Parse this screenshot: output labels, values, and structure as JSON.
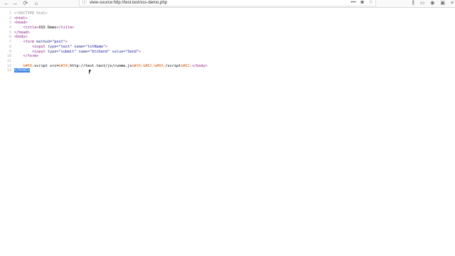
{
  "browser": {
    "url": "view-source:http://test.test/xss-demo.php",
    "buttons": {
      "back": "←",
      "forward": "→",
      "reload": "⟳",
      "home": "⌂"
    },
    "page_actions": {
      "more": "•••",
      "pocket": "◙",
      "bookmark": "☆"
    },
    "tools": {
      "library": "⫼",
      "sidebar": "▭",
      "account": "◉",
      "extension": "▣",
      "menu": "≡"
    }
  },
  "source": {
    "line_numbers": [
      "1",
      "2",
      "3",
      "4",
      "5",
      "6",
      "7",
      "8",
      "9",
      "10",
      "11",
      "12",
      "13"
    ],
    "l1": "<!DOCTYPE html>",
    "l2": "<html>",
    "l3": "<head>",
    "l4_open": "<title>",
    "l4_text": "XSS Demo",
    "l4_close": "</title>",
    "l5": "</head>",
    "l6": "<body>",
    "l7_tag": "<form",
    "l7_attr": " method=",
    "l7_val": "\"post\"",
    "l7_end": ">",
    "l8_tag": "<input",
    "l8_a1": " type=",
    "l8_v1": "\"text\"",
    "l8_a2": " name=",
    "l8_v2": "\"txtName\"",
    "l8_end": ">",
    "l9_tag": "<input",
    "l9_a1": " type=",
    "l9_v1": "\"submit\"",
    "l9_a2": " name=",
    "l9_v2": "\"btnSend\"",
    "l9_a3": " value=",
    "l9_v3": "\"Send\"",
    "l9_end": ">",
    "l10": "</form>",
    "l11": "",
    "l12_e1": "&#60;",
    "l12_t1": "script src=",
    "l12_e2": "&#34;",
    "l12_t2": "http://test.test/js/runme.js",
    "l12_e3": "&#34;",
    "l12_e4": "&#62;",
    "l12_e5": "&#60;",
    "l12_t3": "/script",
    "l12_e6": "&#62;",
    "l12_close": "</body>",
    "l13": "</html>"
  }
}
